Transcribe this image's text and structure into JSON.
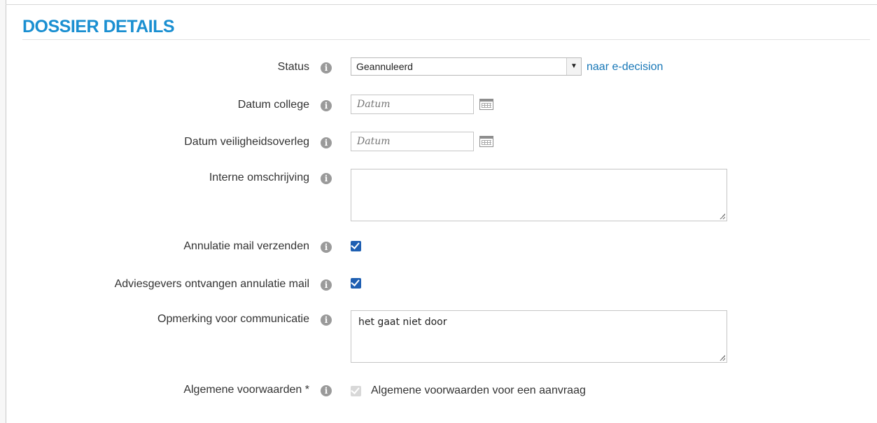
{
  "title": "DOSSIER DETAILS",
  "form": {
    "status": {
      "label": "Status",
      "value": "Geannuleerd",
      "link": "naar e-decision"
    },
    "datum_college": {
      "label": "Datum college",
      "placeholder": "Datum"
    },
    "datum_veiligheidsoverleg": {
      "label": "Datum veiligheidsoverleg",
      "placeholder": "Datum"
    },
    "interne_omschrijving": {
      "label": "Interne omschrijving",
      "value": ""
    },
    "annulatie_mail": {
      "label": "Annulatie mail verzenden",
      "checked": true
    },
    "adviesgevers_mail": {
      "label": "Adviesgevers ontvangen annulatie mail",
      "checked": true
    },
    "opmerking": {
      "label": "Opmerking voor communicatie",
      "value": "het gaat niet door"
    },
    "algemene_voorwaarden": {
      "label": "Algemene voorwaarden *",
      "option_label": "Algemene voorwaarden voor een aanvraag",
      "checked": true,
      "disabled": true
    }
  },
  "icons": {
    "info": "info-icon",
    "calendar": "calendar-icon",
    "dropdown": "chevron-down-icon"
  },
  "colors": {
    "title": "#1a8fd1",
    "link": "#1777b7",
    "checkbox": "#1f5fb2"
  }
}
